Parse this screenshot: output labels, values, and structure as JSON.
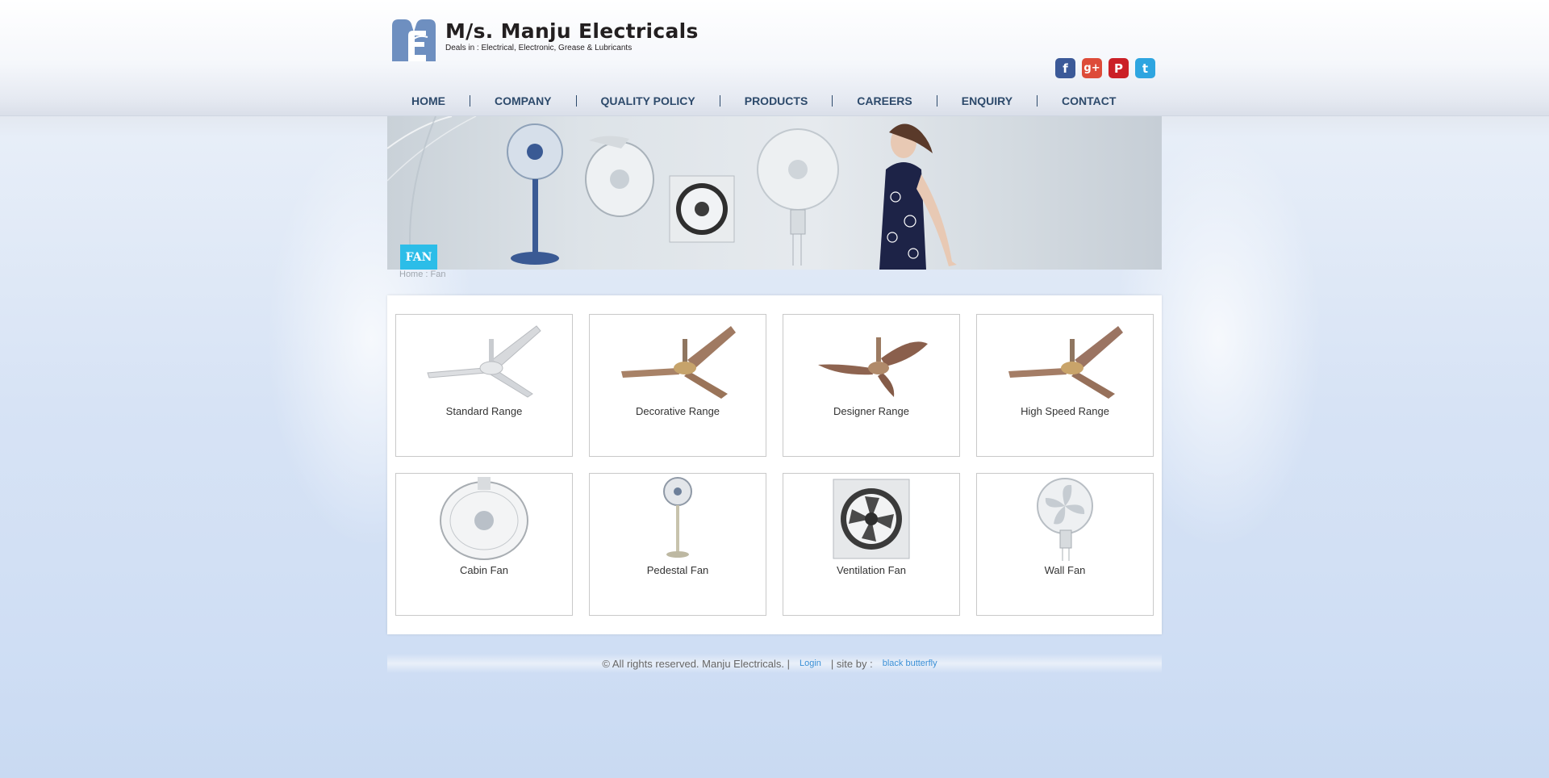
{
  "brand": {
    "title": "M/s. Manju Electricals",
    "subtitle": "Deals in : Electrical, Electronic, Grease & Lubricants"
  },
  "social": [
    {
      "name": "facebook",
      "glyph": "f"
    },
    {
      "name": "google-plus",
      "glyph": "g+"
    },
    {
      "name": "pinterest",
      "glyph": "P"
    },
    {
      "name": "twitter",
      "glyph": "t"
    }
  ],
  "nav": [
    "HOME",
    "COMPANY",
    "QUALITY POLICY",
    "PRODUCTS",
    "CAREERS",
    "ENQUIRY",
    "CONTACT"
  ],
  "banner": {
    "badge": "FAN"
  },
  "breadcrumb": "Home : Fan",
  "products": [
    {
      "label": "Standard Range",
      "icon": "ceiling-fan-white-icon"
    },
    {
      "label": "Decorative Range",
      "icon": "ceiling-fan-bronze-icon"
    },
    {
      "label": "Designer Range",
      "icon": "ceiling-fan-designer-icon"
    },
    {
      "label": "High Speed Range",
      "icon": "ceiling-fan-highspeed-icon"
    },
    {
      "label": "Cabin Fan",
      "icon": "cabin-fan-icon"
    },
    {
      "label": "Pedestal Fan",
      "icon": "pedestal-fan-icon"
    },
    {
      "label": "Ventilation Fan",
      "icon": "ventilation-fan-icon"
    },
    {
      "label": "Wall Fan",
      "icon": "wall-fan-icon"
    }
  ],
  "footer": {
    "copyright": "© All rights reserved. Manju Electricals. |",
    "login": "Login",
    "site_by": "| site by :",
    "designer": "black butterfly"
  }
}
